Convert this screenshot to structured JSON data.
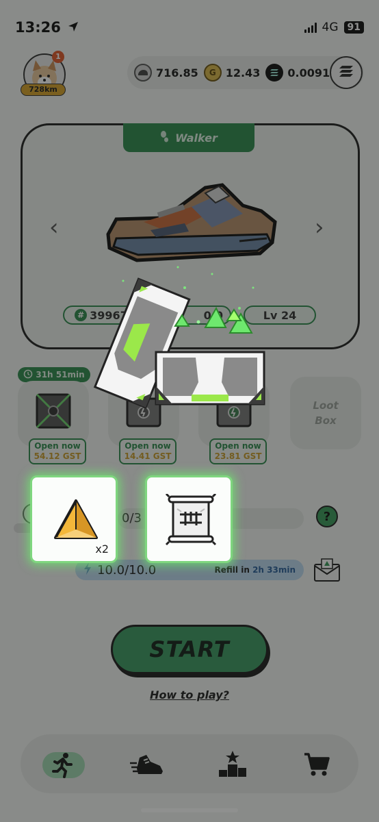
{
  "status_bar": {
    "time": "13:26",
    "network": "4G",
    "battery": "91"
  },
  "profile": {
    "badge_count": "1",
    "distance": "728km"
  },
  "balances": [
    {
      "name": "gst-balance",
      "value": "716.85",
      "icon": "footprint-coin-icon"
    },
    {
      "name": "gmt-balance",
      "value": "12.43",
      "icon": "gmt-coin-icon"
    },
    {
      "name": "sol-balance",
      "value": "0.0091",
      "icon": "solana-coin-icon"
    }
  ],
  "sneaker": {
    "class_label": "Walker",
    "id_prefix": "#",
    "id": "39967",
    "mint_partial": "0.0",
    "level": "Lv 24"
  },
  "mystery_boxes": {
    "timer": "31h 51min",
    "slots": [
      {
        "open_label": "Open now",
        "cost": "54.12 GST"
      },
      {
        "open_label": "Open now",
        "cost": "14.41 GST"
      },
      {
        "open_label": "Open now",
        "cost": "23.81 GST"
      }
    ],
    "loot_box_line1": "Loot",
    "loot_box_line2": "Box"
  },
  "energy": {
    "durability_partial": "0/3",
    "value": "10.0/10.0",
    "refill_label": "Refill in",
    "refill_time": "2h 33min",
    "help": "?"
  },
  "rewards": [
    {
      "icon": "gem-icon",
      "quantity": "x2"
    },
    {
      "icon": "scroll-icon",
      "quantity": ""
    }
  ],
  "actions": {
    "start": "START",
    "how_to_play": "How to play?"
  },
  "nav": [
    "run-icon",
    "sneaker-icon",
    "leaderboard-icon",
    "cart-icon"
  ],
  "colors": {
    "brand_green": "#2f8a4e",
    "gold": "#d6a22a",
    "glow_green": "#7fd67f"
  }
}
